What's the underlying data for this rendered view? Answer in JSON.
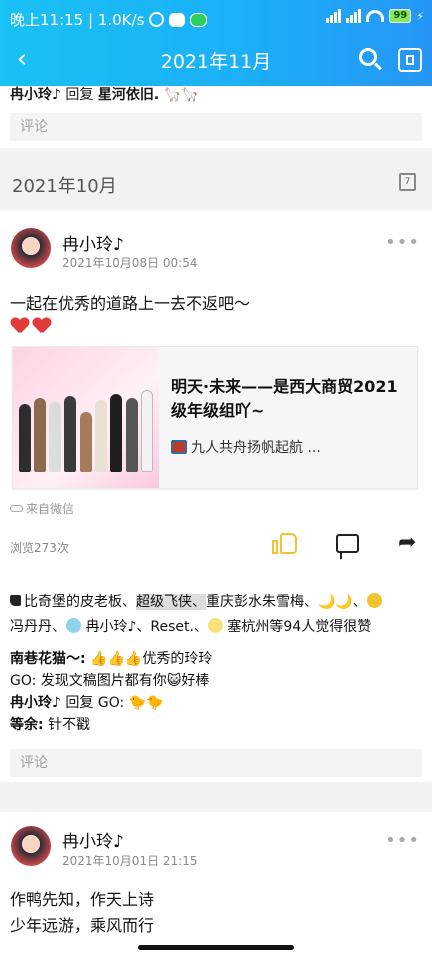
{
  "status_bar": {
    "time": "晚上11:15 | 1.0K/s",
    "battery": "99"
  },
  "nav": {
    "title": "2021年11月"
  },
  "prev_post": {
    "reply_author": "冉小玲♪",
    "reply_word": "回复",
    "reply_target": "星河依旧.",
    "comment_placeholder": "评论"
  },
  "month_header": {
    "label": "2021年10月",
    "calendar_day": "7"
  },
  "post1": {
    "user": "冉小玲♪",
    "time": "2021年10月08日 00:54",
    "text": "一起在优秀的道路上一去不返吧～",
    "share": {
      "title": "明天·未来——是西大商贸2021级年级组吖~",
      "subtitle": "九人共舟扬帆起航 ..."
    },
    "via": "来自微信",
    "views": "浏览273次",
    "likers_line1_a": "比奇堡的皮老板、",
    "likers_highlight": "超级飞侠、",
    "likers_line1_b": "重庆彭水朱雪梅、",
    "likers_line2": "冯丹丹、",
    "likers_line2_b": "冉小玲♪、Reset.、",
    "likers_line2_c": "塞杭州等94人觉得很赞",
    "comments": [
      {
        "author": "南巷花猫～:",
        "text": "👍👍👍优秀的玲玲"
      },
      {
        "author": "GO:",
        "text": "发现文稿图片都有你😺好棒"
      },
      {
        "author": "冉小玲♪",
        "text": "回复 GO: 🐤🐤"
      },
      {
        "author": "等余:",
        "text": "针不戳"
      }
    ],
    "comment_placeholder": "评论"
  },
  "post2": {
    "user": "冉小玲♪",
    "time": "2021年10月01日 21:15",
    "line1": "作鸭先知，作天上诗",
    "line2": "少年远游，乘风而行"
  },
  "colors": {
    "brand_gradient_start": "#19c1f5",
    "brand_gradient_end": "#2596f6",
    "like_yellow": "#f3c330"
  }
}
